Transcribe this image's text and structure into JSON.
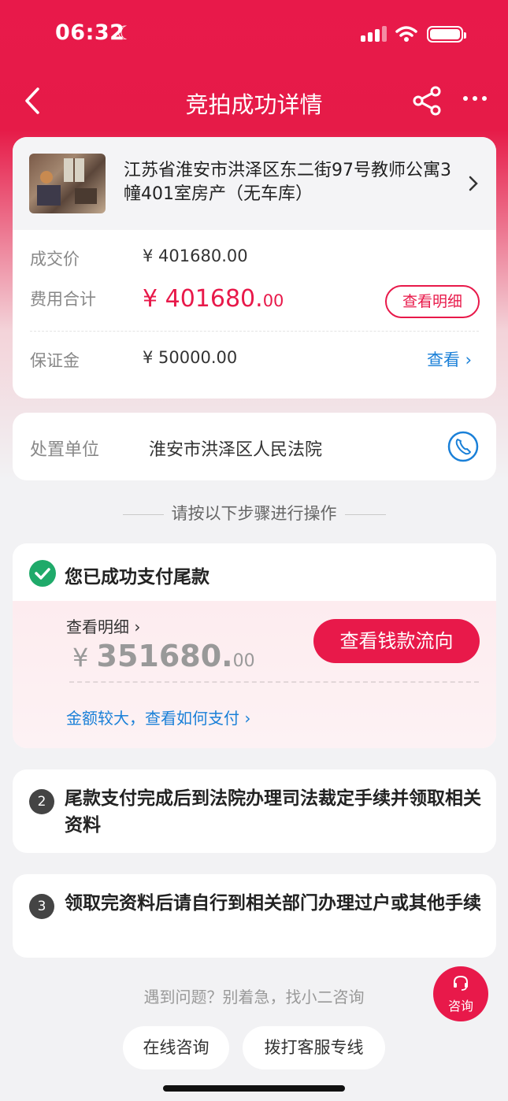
{
  "status_bar": {
    "time": "06:32"
  },
  "nav": {
    "title": "竞拍成功详情"
  },
  "property": {
    "title": "江苏省淮安市洪泽区东二街97号教师公寓3幢401室房产（无车库）",
    "deal_price_label": "成交价",
    "deal_price_value": "¥ 401680.00",
    "total_fee_label": "费用合计",
    "total_fee_int": "¥ 401680.",
    "total_fee_dec": "00",
    "view_detail_button": "查看明细",
    "deposit_label": "保证金",
    "deposit_value": "¥ 50000.00",
    "deposit_view_link": "查看 ›"
  },
  "org": {
    "label": "处置单位",
    "value": "淮安市洪泽区人民法院"
  },
  "steps_heading": "请按以下步骤进行操作",
  "step1": {
    "title": "您已成功支付尾款",
    "detail_link": "查看明细 ›",
    "amount_yen": "¥ ",
    "amount_int": "351680.",
    "amount_dec": "00",
    "flow_button": "查看钱款流向",
    "large_amount_link": "金额较大，查看如何支付 ›"
  },
  "step2": {
    "number": "2",
    "text": "尾款支付完成后到法院办理司法裁定手续并领取相关资料"
  },
  "step3": {
    "number": "3",
    "text": "领取完资料后请自行到相关部门办理过户或其他手续"
  },
  "help": {
    "text": "遇到问题？别着急，找小二咨询",
    "fab_label": "咨询",
    "online_button": "在线咨询",
    "hotline_button": "拨打客服专线"
  },
  "colors": {
    "accent": "#e8194a",
    "link": "#1a80d8",
    "success": "#1faa6a"
  }
}
